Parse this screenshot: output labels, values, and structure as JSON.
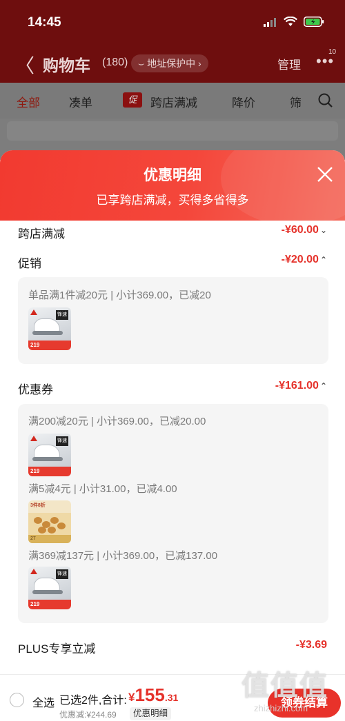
{
  "status_bar": {
    "time": "14:45"
  },
  "nav": {
    "back": "〈",
    "title": "购物车",
    "count": "(180)",
    "address_protect": "⌣ 地址保护中 ›",
    "manage": "管理",
    "more": "•••",
    "badge": "10"
  },
  "tabs": [
    {
      "label": "全部"
    },
    {
      "label": "凑单"
    },
    {
      "label": "跨店满减",
      "badge": "促"
    },
    {
      "label": "降价"
    },
    {
      "label": "筛"
    }
  ],
  "sheet": {
    "title": "优惠明细",
    "subtitle": "已享跨店满减，买得多省得多",
    "sections": {
      "cross_store": {
        "label": "跨店满减",
        "value": "-¥60.00",
        "chevron": "⌄"
      },
      "promo": {
        "label": "促销",
        "value": "-¥20.00",
        "chevron": "⌃"
      },
      "coupon": {
        "label": "优惠券",
        "value": "-¥161.00",
        "chevron": "⌃"
      },
      "plus": {
        "label": "PLUS专享立减",
        "value": "-¥3.69"
      }
    },
    "promo_lines": [
      "单品满1件减20元 | 小计369.00，已减20"
    ],
    "coupon_lines": [
      "满200减20元 | 小计369.00，已减20.00",
      "满5减4元 | 小计31.00，已减4.00",
      "满369减137元 | 小计369.00，已减137.00"
    ]
  },
  "thumbs": {
    "shoe_brand": "锋速",
    "shoe_price": "219",
    "snack_tag": "3件8折",
    "snack_bar": "27"
  },
  "bottom": {
    "select_all": "全选",
    "selected": "已选2件,合计:",
    "currency": "¥",
    "total_int": "155",
    "total_dec": ".31",
    "saved": "优惠减:¥244.69",
    "detail": "优惠明细",
    "checkout": "领券结算"
  },
  "watermark": {
    "big": "值值值",
    "small": "zhizhizhi.com"
  },
  "colors": {
    "accent": "#e5312a",
    "header_dim": "#6e0e0e"
  }
}
